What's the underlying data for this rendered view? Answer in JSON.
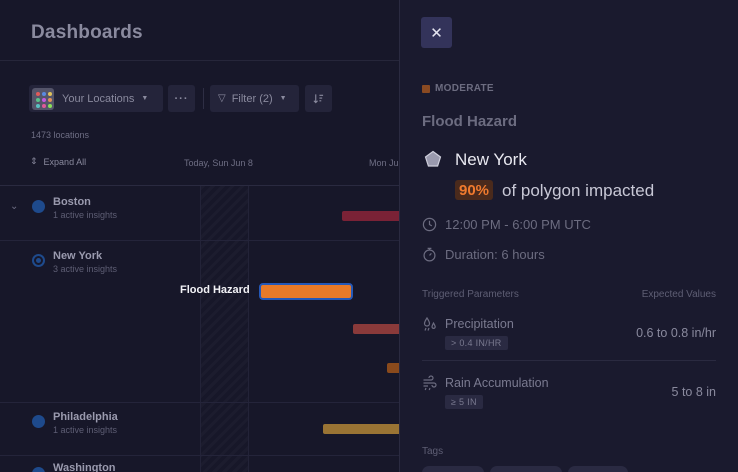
{
  "dashboard": {
    "title": "Dashboards",
    "toolbar": {
      "location_select": "Your Locations",
      "more_label": "···",
      "filter_label": "Filter (2)",
      "sort_icon": "sort-icon"
    },
    "location_count": "1473 locations",
    "expand_all": "Expand All",
    "timeline": {
      "date_today": "Today, Sun Jun 8",
      "date_next": "Mon Ju"
    },
    "rows": [
      {
        "name": "Boston",
        "sub": "1 active insights"
      },
      {
        "name": "New York",
        "sub": "3 active insights"
      },
      {
        "name": "Philadelphia",
        "sub": "1 active insights"
      },
      {
        "name": "Washington",
        "sub": ""
      }
    ],
    "highlighted_bar_label": "Flood Hazard",
    "colors": {
      "flood_bar": "#e87a28",
      "selection_ring": "#2458b8",
      "red_bar": "#7a2236",
      "gold_bar": "#9a7434"
    }
  },
  "panel": {
    "close_icon": "close-icon",
    "severity": "MODERATE",
    "insight_title": "Flood Hazard",
    "location_name": "New York",
    "impact_percent": "90%",
    "impact_text": "of polygon impacted",
    "time_range": "12:00 PM - 6:00 PM UTC",
    "duration": "Duration: 6 hours",
    "params_header": "Triggered Parameters",
    "values_header": "Expected Values",
    "parameters": [
      {
        "name": "Precipitation",
        "threshold": "> 0.4 IN/HR",
        "value": "0.6 to 0.8 in/hr",
        "icon": "rain-drops-icon"
      },
      {
        "name": "Rain Accumulation",
        "threshold": "≥ 5 IN",
        "value": "5 to 8 in",
        "icon": "rain-wind-icon"
      }
    ],
    "tags_header": "Tags",
    "colors": {
      "severity": "#8a4a22",
      "impact": "#f07a2e",
      "impact_bg": "#4a2a1c"
    }
  }
}
